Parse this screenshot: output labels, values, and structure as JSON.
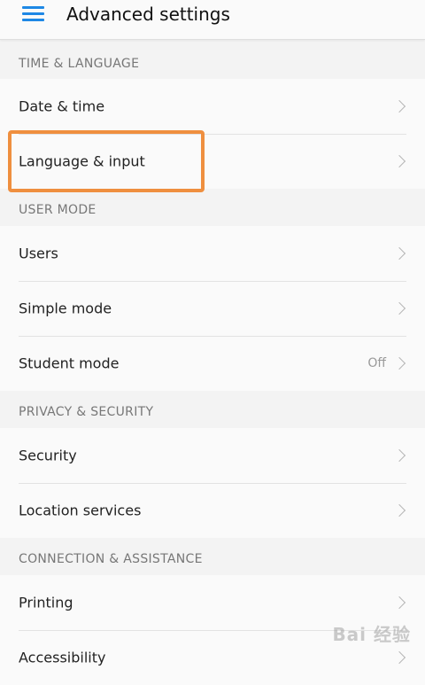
{
  "header": {
    "title": "Advanced settings",
    "menu_icon": "hamburger-menu-icon",
    "accent": "#1e88e5"
  },
  "sections": [
    {
      "header": "TIME & LANGUAGE",
      "items": [
        {
          "label": "Date & time"
        },
        {
          "label": "Language & input"
        }
      ]
    },
    {
      "header": "USER MODE",
      "items": [
        {
          "label": "Users"
        },
        {
          "label": "Simple mode"
        },
        {
          "label": "Student mode",
          "value": "Off"
        }
      ]
    },
    {
      "header": "PRIVACY & SECURITY",
      "items": [
        {
          "label": "Security"
        },
        {
          "label": "Location services"
        }
      ]
    },
    {
      "header": "CONNECTION & ASSISTANCE",
      "items": [
        {
          "label": "Printing"
        },
        {
          "label": "Accessibility"
        }
      ]
    }
  ],
  "annotation": {
    "highlight_color": "#ef8f3f",
    "highlighted_item": "Language & input"
  },
  "watermark": {
    "text": "Bai 经验"
  }
}
